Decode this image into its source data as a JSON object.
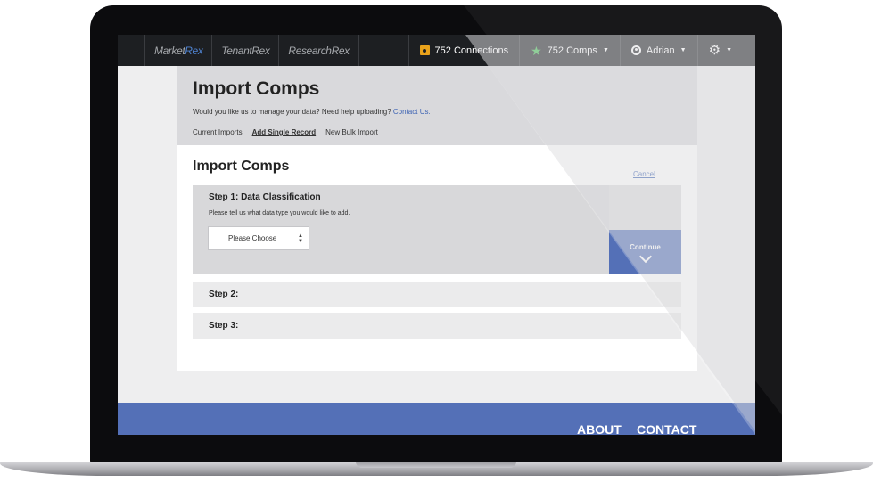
{
  "nav": {
    "brands": [
      {
        "name_main": "Market",
        "name_accent": "Rex"
      },
      {
        "name_main": "TenantRex",
        "name_accent": ""
      },
      {
        "name_main": "ResearchRex",
        "name_accent": ""
      }
    ],
    "connections_label": "752 Connections",
    "comps_label": "752 Comps",
    "user_label": "Adrian",
    "icons": {
      "connections": "contact-card-icon",
      "comps": "star-icon",
      "user": "user-icon",
      "settings": "gear-icon"
    }
  },
  "header": {
    "title": "Import Comps",
    "help_text": "Would you like us to manage your data?  Need help uploading?",
    "help_link": "Contact Us.",
    "tabs": [
      "Current Imports",
      "Add Single Record",
      "New Bulk Import"
    ],
    "active_tab": "Add Single Record"
  },
  "card": {
    "title": "Import Comps",
    "cancel_label": "Cancel",
    "step1": {
      "heading": "Step 1: Data Classification",
      "description": "Please tell us what data type you would like to add.",
      "select_value": "Please Choose",
      "continue_label": "Continue"
    },
    "step2_heading": "Step 2:",
    "step3_heading": "Step 3:"
  },
  "footer": {
    "about": "ABOUT",
    "contact": "CONTACT"
  },
  "colors": {
    "nav_bg": "#1d1f22",
    "accent_blue": "#5470b7",
    "link_blue": "#3e64b4",
    "comps_star": "#3fbf4f",
    "connections_icon": "#e9a21b"
  }
}
